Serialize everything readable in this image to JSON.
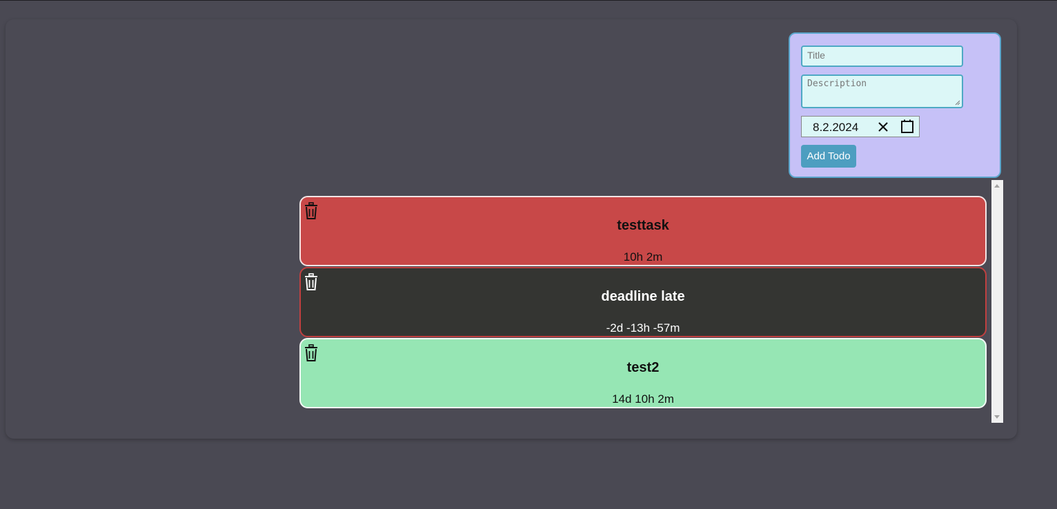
{
  "form": {
    "title_placeholder": "Title",
    "description_placeholder": "Description",
    "date_value": "8.2.2024",
    "add_button": "Add Todo"
  },
  "todos": [
    {
      "title": "testtask",
      "time_left": "10h 2m",
      "status": "due-soon",
      "bg": "#c84848",
      "border": "#f3e6e6",
      "text_color": "#111111"
    },
    {
      "title": "deadline late",
      "time_left": "-2d -13h -57m",
      "status": "late",
      "bg": "#343532",
      "border": "#c04040",
      "text_color": "#ffffff"
    },
    {
      "title": "test2",
      "time_left": "14d 10h 2m",
      "status": "ok",
      "bg": "#96e6b4",
      "border": "#f4fbf6",
      "text_color": "#111111"
    }
  ],
  "icons": {
    "delete": "trash-icon",
    "clear": "close-icon",
    "calendar": "calendar-icon"
  }
}
